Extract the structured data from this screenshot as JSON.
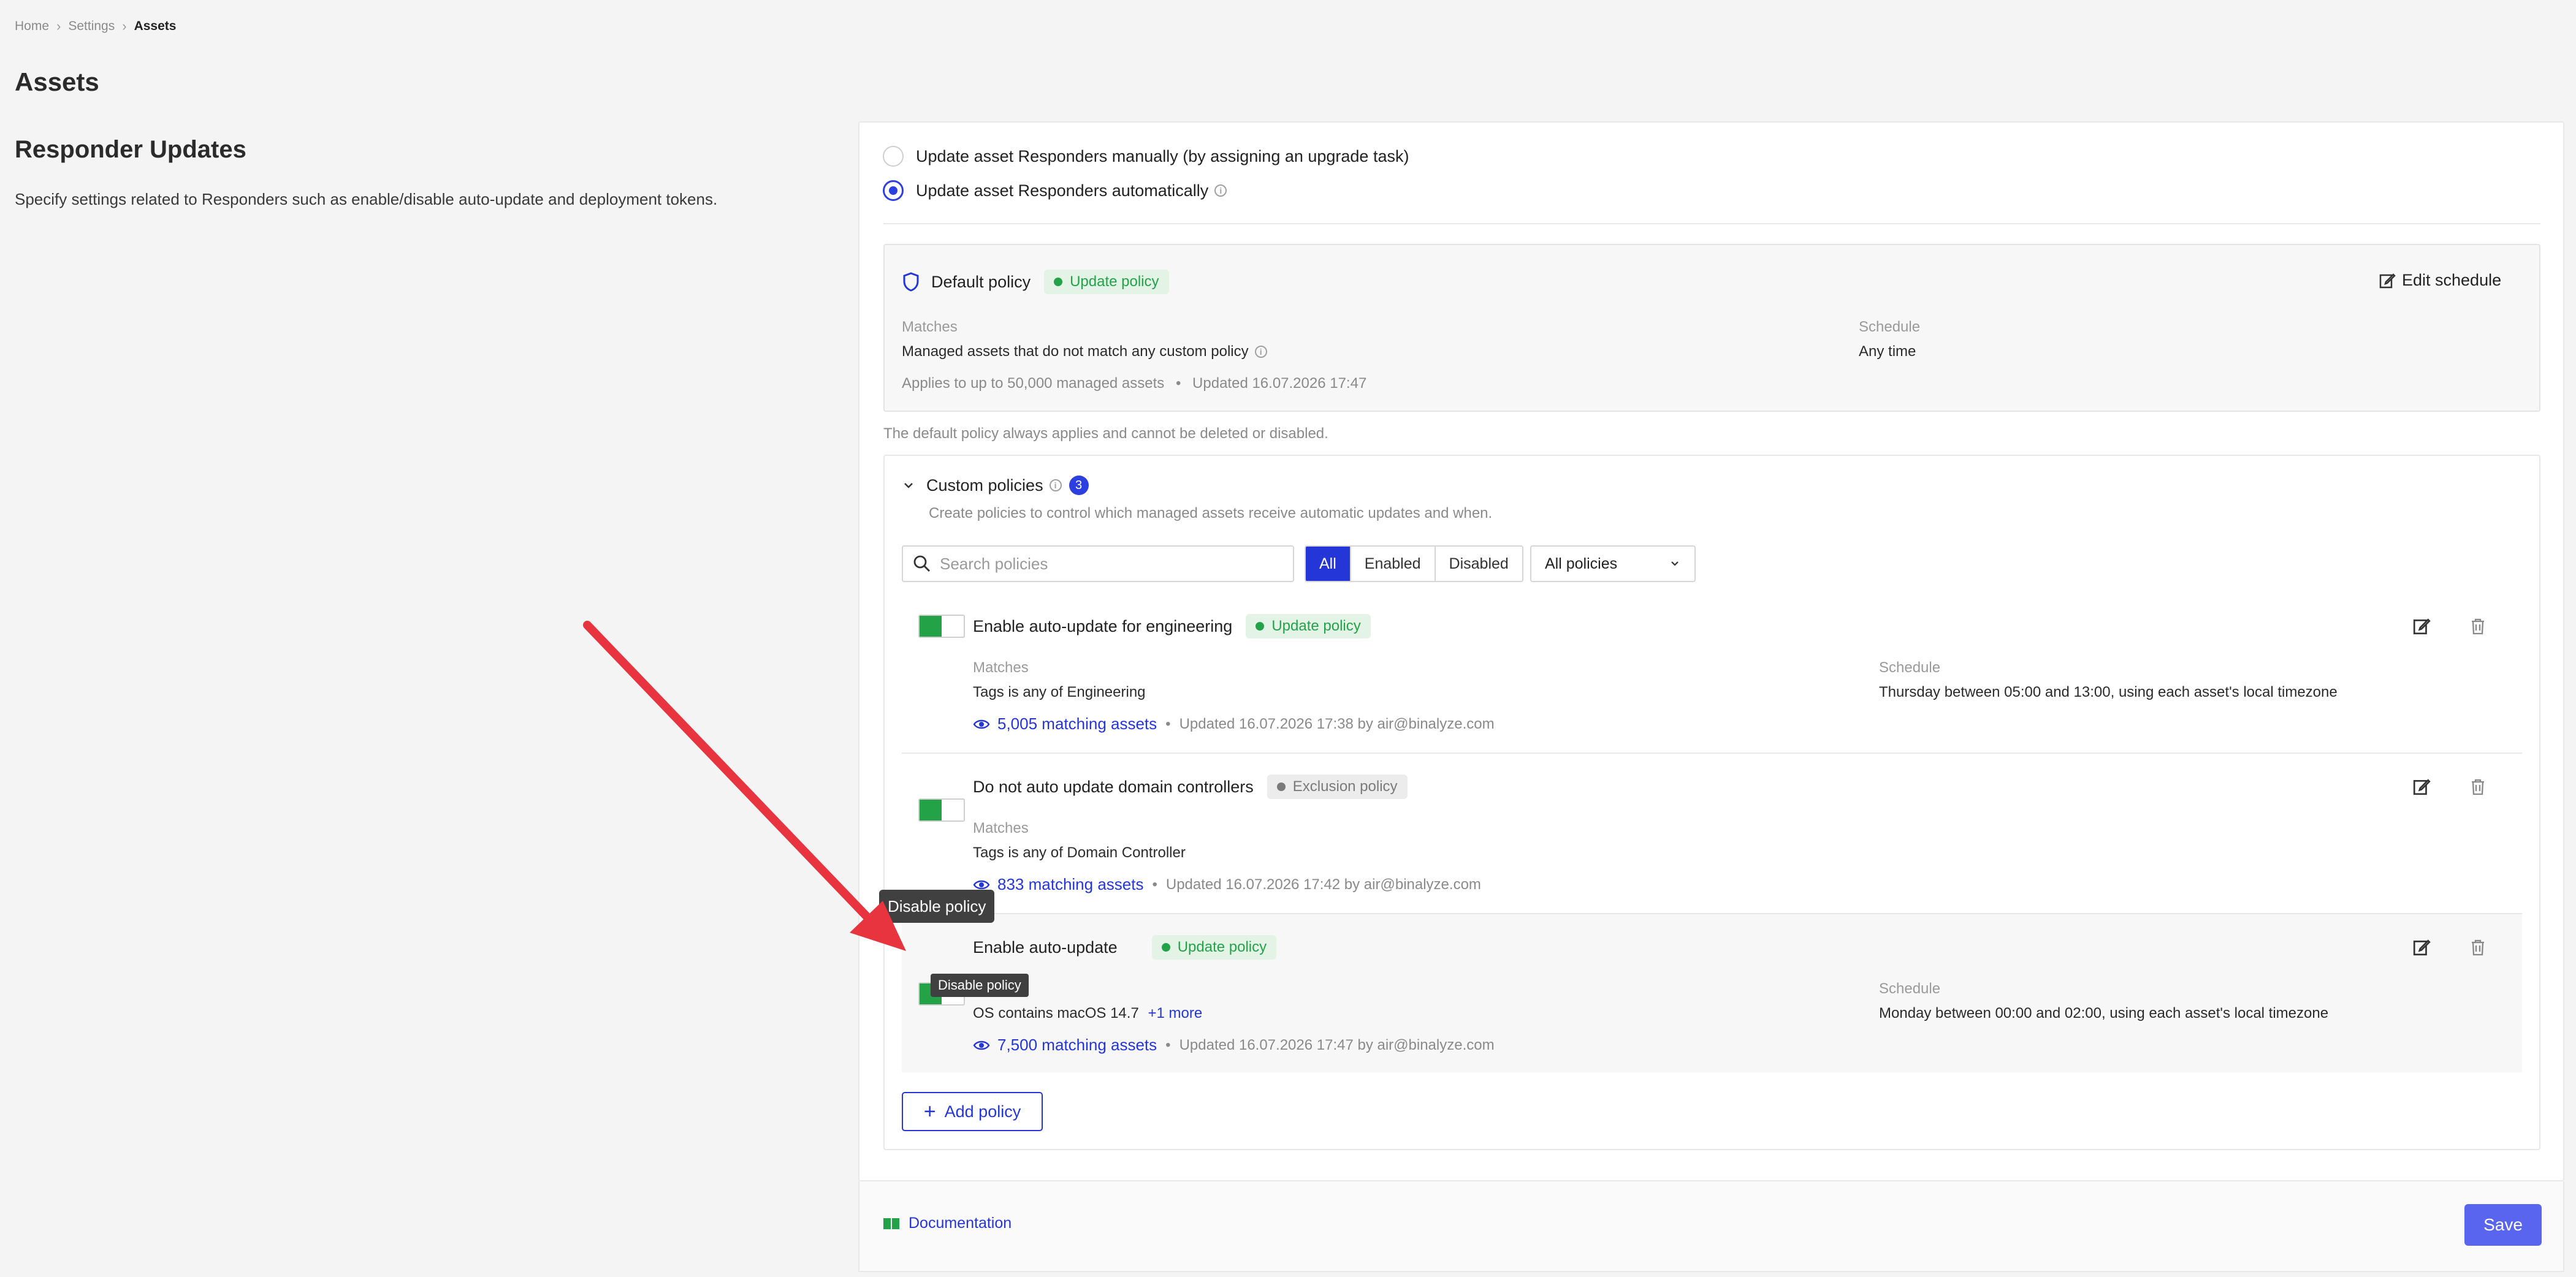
{
  "breadcrumb": {
    "home": "Home",
    "settings": "Settings",
    "current": "Assets"
  },
  "page_title": "Assets",
  "section": {
    "title": "Responder Updates",
    "description": "Specify settings related to Responders such as enable/disable auto-update and deployment tokens."
  },
  "update_mode": {
    "manual_label": "Update asset Responders manually (by assigning an upgrade task)",
    "auto_label": "Update asset Responders automatically",
    "selected": "auto"
  },
  "default_policy": {
    "title": "Default policy",
    "badge": "Update policy",
    "edit_label": "Edit schedule",
    "matches_label": "Matches",
    "matches_value": "Managed assets that do not match any custom policy",
    "schedule_label": "Schedule",
    "schedule_value": "Any time",
    "applies": "Applies to up to 50,000 managed assets",
    "bullet": "•",
    "updated": "Updated 16.07.2026 17:47",
    "note": "The default policy always applies and cannot be deleted or disabled."
  },
  "custom_policies": {
    "title": "Custom policies",
    "count": "3",
    "description": "Create policies to control which managed assets receive automatic updates and when.",
    "search_placeholder": "Search policies",
    "filters": [
      "All",
      "Enabled",
      "Disabled"
    ],
    "active_filter": "All",
    "select_value": "All policies",
    "add_label": "Add policy",
    "policies": [
      {
        "title": "Enable auto-update for engineering",
        "badge": "Update policy",
        "badge_type": "green",
        "matches_label": "Matches",
        "matches_value": "Tags is any of Engineering",
        "schedule_label": "Schedule",
        "schedule_value": "Thursday between 05:00 and 13:00, using each asset's local timezone",
        "matching": "5,005 matching assets",
        "updated": "Updated 16.07.2026 17:38 by air@binalyze.com",
        "enabled": true
      },
      {
        "title": "Do not auto update domain controllers",
        "badge": "Exclusion policy",
        "badge_type": "gray",
        "matches_label": "Matches",
        "matches_value": "Tags is any of Domain Controller",
        "matching": "833 matching assets",
        "updated": "Updated 16.07.2026 17:42 by air@binalyze.com",
        "enabled": true
      },
      {
        "title": "Enable auto-update",
        "badge": "Update policy",
        "badge_type": "green",
        "matches_value": "OS contains macOS 14.7",
        "more_link": "+1 more",
        "schedule_label": "Schedule",
        "schedule_value": "Monday between 00:00 and 02:00, using each asset's local timezone",
        "matching": "7,500 matching assets",
        "updated": "Updated 16.07.2026 17:47 by air@binalyze.com",
        "enabled": true
      }
    ]
  },
  "tooltip": {
    "large": "Disable policy",
    "small": "Disable policy"
  },
  "footer": {
    "doc_label": "Documentation",
    "save_label": "Save"
  },
  "colors": {
    "accent": "#2436d8",
    "success": "#23a248",
    "annotation_arrow": "#e8343f"
  }
}
